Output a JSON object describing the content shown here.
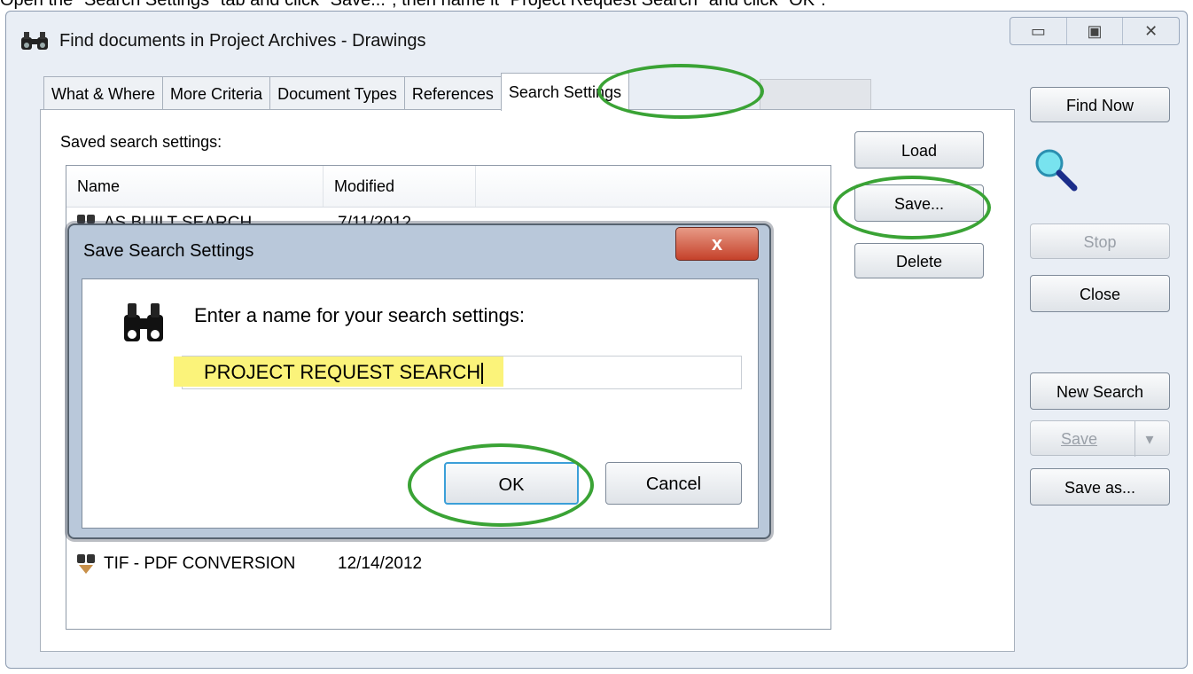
{
  "instruction": "Open the \"Search Settings\" tab and click \"Save...\", then name it \"Project Request Search\" and click \"OK\".",
  "window": {
    "title": "Find documents in Project Archives - Drawings",
    "tabs": [
      "What & Where",
      "More Criteria",
      "Document Types",
      "References",
      "Search Settings"
    ],
    "active_tab": "Search Settings"
  },
  "search_settings": {
    "label": "Saved search settings:",
    "columns": [
      "Name",
      "Modified"
    ],
    "rows": [
      {
        "name": "AS BUILT SEARCH",
        "modified": "7/11/2012"
      },
      {
        "name": "TIF - PDF CONVERSION",
        "modified": "12/14/2012"
      }
    ],
    "buttons": {
      "load": "Load",
      "save": "Save...",
      "delete": "Delete"
    }
  },
  "right_buttons": {
    "find_now": "Find Now",
    "stop": "Stop",
    "close": "Close",
    "new_search": "New Search",
    "save": "Save",
    "save_as": "Save as..."
  },
  "dialog": {
    "title": "Save Search Settings",
    "close_glyph": "x",
    "prompt": "Enter a name for your search settings:",
    "input_value": "PROJECT REQUEST SEARCH",
    "ok": "OK",
    "cancel": "Cancel"
  },
  "colors": {
    "annotation": "#3aa335",
    "highlight": "#fbf37a",
    "dialog_frame": "#b9c8da"
  },
  "icons": [
    "binoculars-icon",
    "magnifier-icon",
    "saved-search-icon",
    "minimize-icon",
    "maximize-icon",
    "close-icon",
    "dropdown-arrow-icon"
  ]
}
